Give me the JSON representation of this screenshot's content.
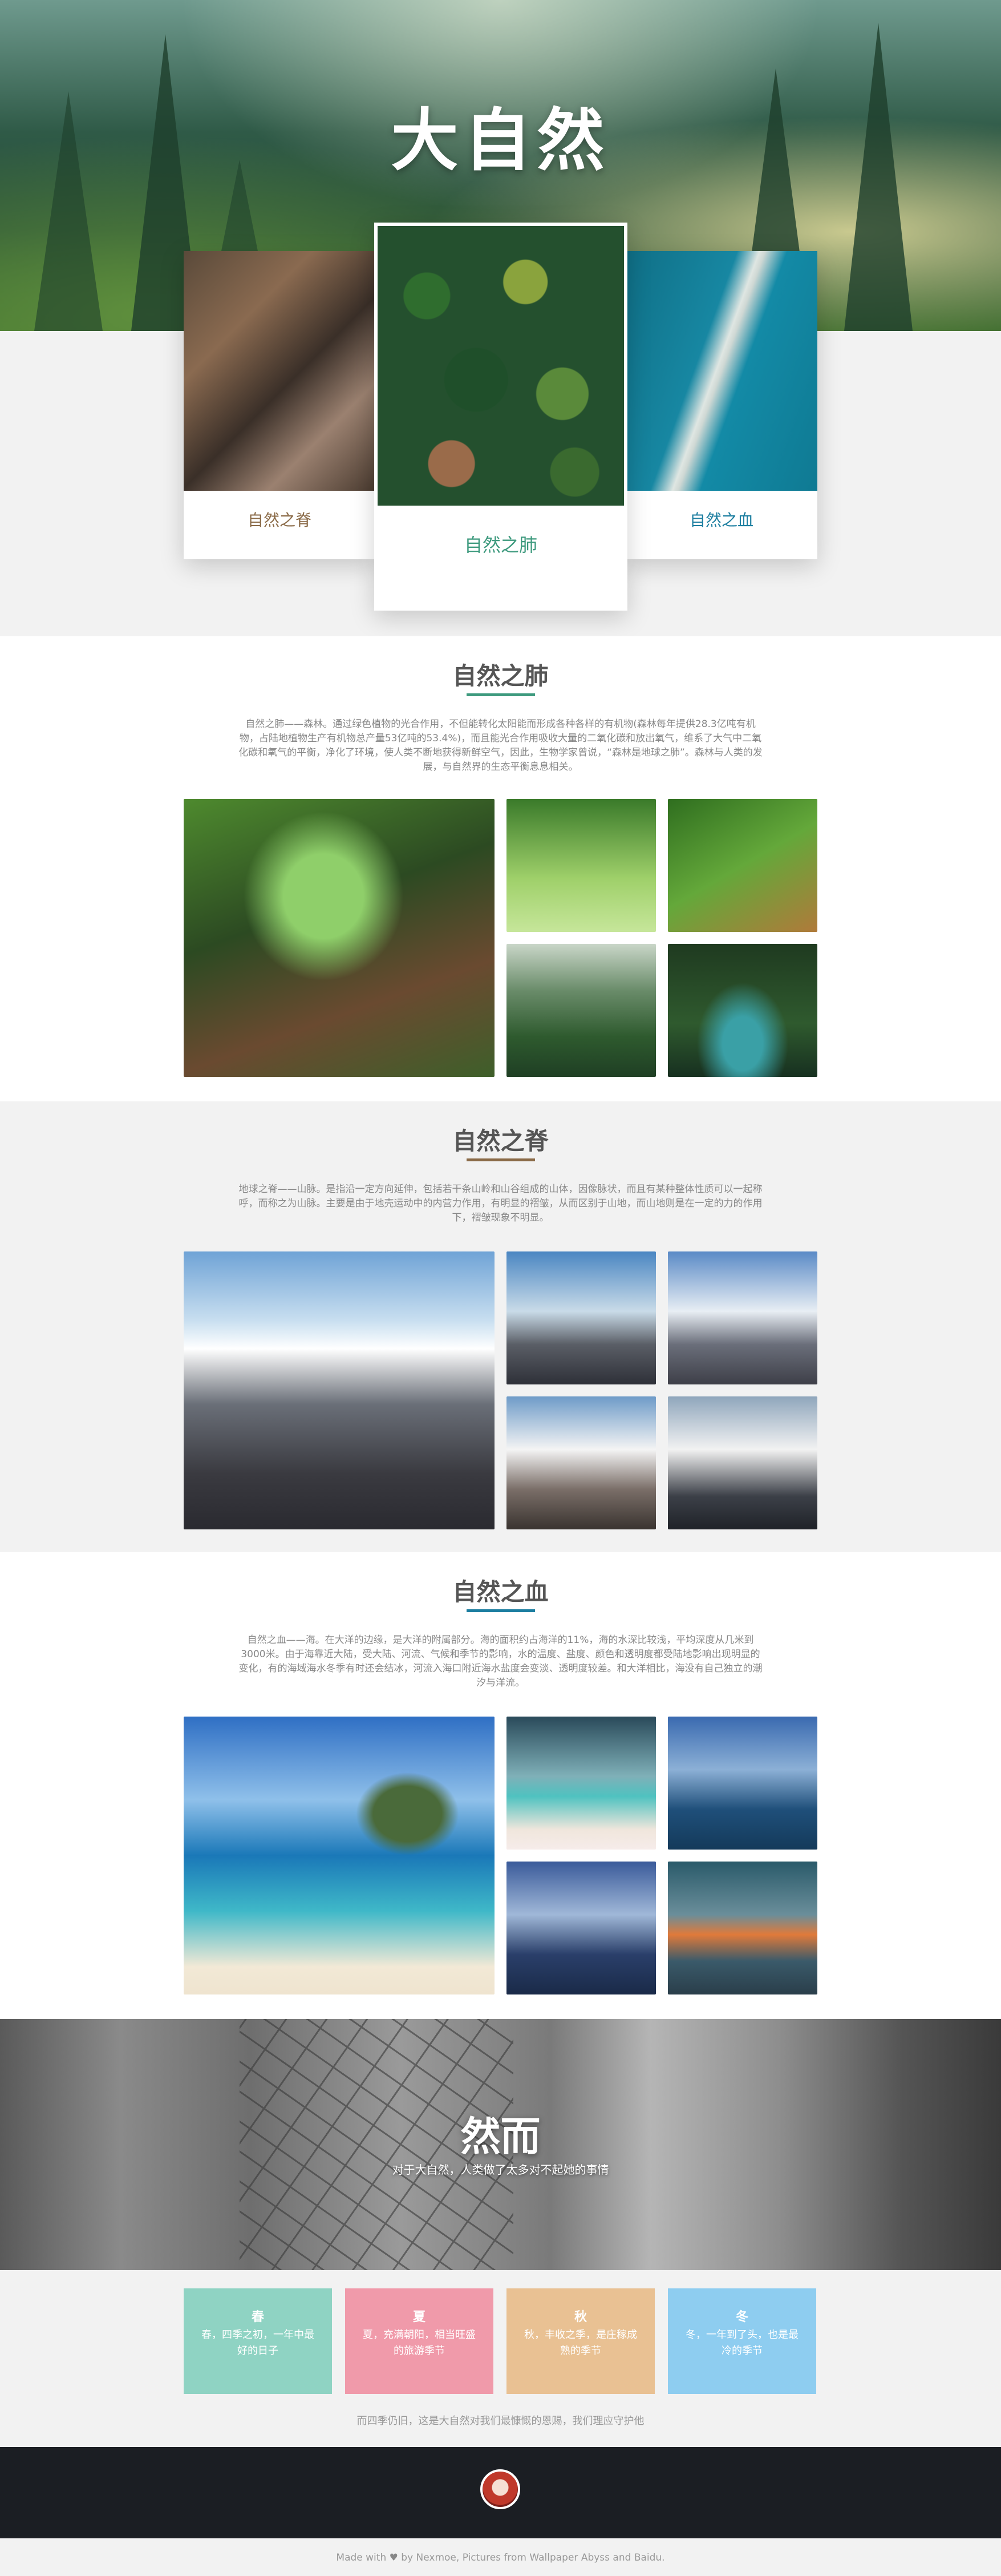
{
  "hero": {
    "title": "大自然"
  },
  "cards": {
    "left": {
      "label": "自然之脊"
    },
    "center": {
      "label": "自然之肺"
    },
    "right": {
      "label": "自然之血"
    }
  },
  "sections": {
    "lung": {
      "title": "自然之肺",
      "underline_color": "#3e9a7e",
      "text": "自然之肺——森林。通过绿色植物的光合作用，不但能转化太阳能而形成各种各样的有机物(森林每年提供28.3亿吨有机物，占陆地植物生产有机物总产量53亿吨的53.4%)，而且能光合作用吸收大量的二氧化碳和放出氧气，维系了大气中二氧化碳和氧气的平衡，净化了环境，使人类不断地获得新鲜空气，因此，生物学家曾说，“森林是地球之肺”。森林与人类的发展，与自然界的生态平衡息息相关。"
    },
    "spine": {
      "title": "自然之脊",
      "underline_color": "#8a6a47",
      "text": "地球之脊——山脉。是指沿一定方向延伸，包括若干条山岭和山谷组成的山体，因像脉状，而且有某种整体性质可以一起称呼，而称之为山脉。主要是由于地壳运动中的内营力作用，有明显的褶皱，从而区别于山地，而山地则是在一定的力的作用下，褶皱现象不明显。"
    },
    "blood": {
      "title": "自然之血",
      "underline_color": "#1c7ea0",
      "text": "自然之血——海。在大洋的边缘，是大洋的附属部分。海的面积约占海洋的11%，海的水深比较浅，平均深度从几米到3000米。由于海靠近大陆，受大陆、河流、气候和季节的影响，水的温度、盐度、颜色和透明度都受陆地影响出现明显的变化，有的海域海水冬季有时还会结冰，河流入海口附近海水盐度会变淡、透明度较差。和大洋相比，海没有自己独立的潮汐与洋流。"
    }
  },
  "banner": {
    "title": "然而",
    "subtitle": "对于大自然，人类做了太多对不起她的事情"
  },
  "seasons": {
    "items": [
      {
        "name": "春",
        "desc": "春，四季之初，一年中最好的日子",
        "color": "#8fd3c3"
      },
      {
        "name": "夏",
        "desc": "夏，充满朝阳，相当旺盛的旅游季节",
        "color": "#f09aaa"
      },
      {
        "name": "秋",
        "desc": "秋，丰收之季，是庄稼成熟的季节",
        "color": "#e9c193"
      },
      {
        "name": "冬",
        "desc": "冬，一年到了头，也是最冷的季节",
        "color": "#8ecdf0"
      }
    ],
    "footer": "而四季仍旧，这是大自然对我们最慷慨的恩赐，我们理应守护他"
  },
  "footer": {
    "made_with": "Made with",
    "heart": "♥",
    "credits": "by Nexmoe, Pictures from Wallpaper Abyss and Baidu."
  }
}
